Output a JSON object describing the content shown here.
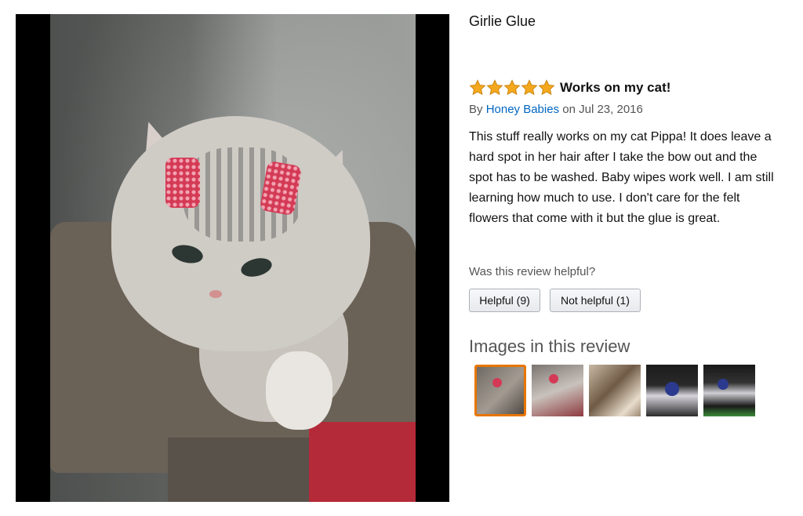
{
  "product": {
    "title": "Girlie Glue"
  },
  "review": {
    "rating": 5,
    "rating_max": 5,
    "title": "Works on my cat!",
    "by_prefix": "By",
    "author": "Honey Babies",
    "date_text": "on Jul 23, 2016",
    "body": "This stuff really works on my cat Pippa! It does leave a hard spot in her hair after I take the bow out and the spot has to be washed. Baby wipes work well. I am still learning how much to use. I don't care for the felt flowers that come with it but the glue is great."
  },
  "helpful": {
    "question": "Was this review helpful?",
    "helpful_label": "Helpful (9)",
    "not_helpful_label": "Not helpful (1)"
  },
  "images": {
    "title": "Images in this review",
    "selected_index": 0,
    "count": 5
  },
  "colors": {
    "star": "#f4a81d",
    "link": "#0066c0",
    "selected_thumb_border": "#e77600"
  }
}
